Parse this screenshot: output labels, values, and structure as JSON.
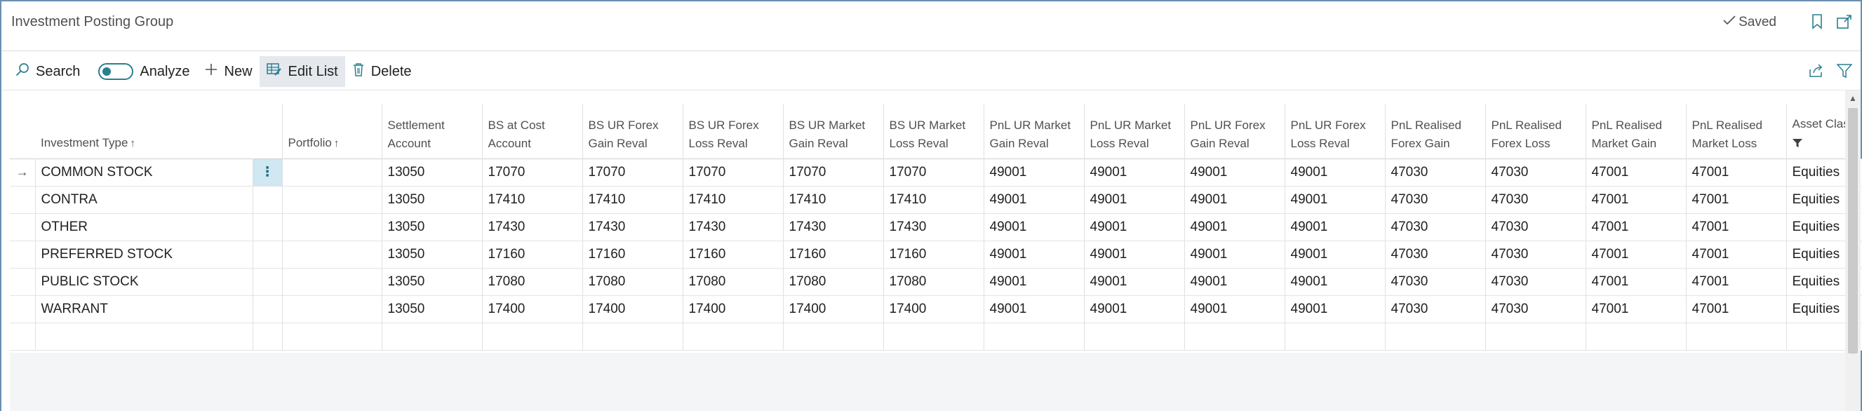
{
  "page": {
    "title": "Investment Posting Group",
    "saved_label": "Saved"
  },
  "header_icons": [
    "bookmark-icon",
    "open-in-new-window-icon"
  ],
  "actions": {
    "search": "Search",
    "analyze": "Analyze",
    "new": "New",
    "edit_list": "Edit List",
    "delete": "Delete"
  },
  "right_icons": [
    "share-icon",
    "filter-icon"
  ],
  "colors": {
    "accent": "#2a7f8f",
    "selected_cell": "#cfe8f2",
    "active_action_bg": "#e5e9ee",
    "border": "#6b8fb0"
  },
  "columns": [
    {
      "key": "investment_type",
      "line1": "Investment Type",
      "line2": "",
      "sorted": "asc"
    },
    {
      "key": "portfolio",
      "line1": "Portfolio",
      "line2": "",
      "sorted": "asc"
    },
    {
      "key": "settlement_account",
      "line1": "Settlement",
      "line2": "Account"
    },
    {
      "key": "bs_at_cost",
      "line1": "BS at Cost",
      "line2": "Account"
    },
    {
      "key": "bs_ur_forex_gain",
      "line1": "BS UR Forex",
      "line2": "Gain Reval"
    },
    {
      "key": "bs_ur_forex_loss",
      "line1": "BS UR Forex",
      "line2": "Loss Reval"
    },
    {
      "key": "bs_ur_market_gain",
      "line1": "BS UR Market",
      "line2": "Gain Reval"
    },
    {
      "key": "bs_ur_market_loss",
      "line1": "BS UR Market",
      "line2": "Loss Reval"
    },
    {
      "key": "pnl_ur_market_gain",
      "line1": "PnL UR Market",
      "line2": "Gain Reval"
    },
    {
      "key": "pnl_ur_market_loss",
      "line1": "PnL UR Market",
      "line2": "Loss Reval"
    },
    {
      "key": "pnl_ur_forex_gain",
      "line1": "PnL UR Forex",
      "line2": "Gain Reval"
    },
    {
      "key": "pnl_ur_forex_loss",
      "line1": "PnL UR Forex",
      "line2": "Loss Reval"
    },
    {
      "key": "pnl_realised_forex_gain",
      "line1": "PnL Realised",
      "line2": "Forex Gain"
    },
    {
      "key": "pnl_realised_forex_loss",
      "line1": "PnL Realised",
      "line2": "Forex Loss"
    },
    {
      "key": "pnl_realised_market_gain",
      "line1": "PnL Realised",
      "line2": "Market Gain"
    },
    {
      "key": "pnl_realised_market_loss",
      "line1": "PnL Realised",
      "line2": "Market Loss"
    },
    {
      "key": "asset_class",
      "line1": "Asset Class",
      "line2": "",
      "filtered": true
    }
  ],
  "rows": [
    {
      "investment_type": "COMMON STOCK",
      "portfolio": "",
      "values": [
        "13050",
        "17070",
        "17070",
        "17070",
        "17070",
        "17070",
        "49001",
        "49001",
        "49001",
        "49001",
        "47030",
        "47030",
        "47001",
        "47001"
      ],
      "asset_class": "Equities",
      "current": true
    },
    {
      "investment_type": "CONTRA",
      "portfolio": "",
      "values": [
        "13050",
        "17410",
        "17410",
        "17410",
        "17410",
        "17410",
        "49001",
        "49001",
        "49001",
        "49001",
        "47030",
        "47030",
        "47001",
        "47001"
      ],
      "asset_class": "Equities"
    },
    {
      "investment_type": "OTHER",
      "portfolio": "",
      "values": [
        "13050",
        "17430",
        "17430",
        "17430",
        "17430",
        "17430",
        "49001",
        "49001",
        "49001",
        "49001",
        "47030",
        "47030",
        "47001",
        "47001"
      ],
      "asset_class": "Equities"
    },
    {
      "investment_type": "PREFERRED STOCK",
      "portfolio": "",
      "values": [
        "13050",
        "17160",
        "17160",
        "17160",
        "17160",
        "17160",
        "49001",
        "49001",
        "49001",
        "49001",
        "47030",
        "47030",
        "47001",
        "47001"
      ],
      "asset_class": "Equities"
    },
    {
      "investment_type": "PUBLIC STOCK",
      "portfolio": "",
      "values": [
        "13050",
        "17080",
        "17080",
        "17080",
        "17080",
        "17080",
        "49001",
        "49001",
        "49001",
        "49001",
        "47030",
        "47030",
        "47001",
        "47001"
      ],
      "asset_class": "Equities"
    },
    {
      "investment_type": "WARRANT",
      "portfolio": "",
      "values": [
        "13050",
        "17400",
        "17400",
        "17400",
        "17400",
        "17400",
        "49001",
        "49001",
        "49001",
        "49001",
        "47030",
        "47030",
        "47001",
        "47001"
      ],
      "asset_class": "Equities"
    }
  ]
}
